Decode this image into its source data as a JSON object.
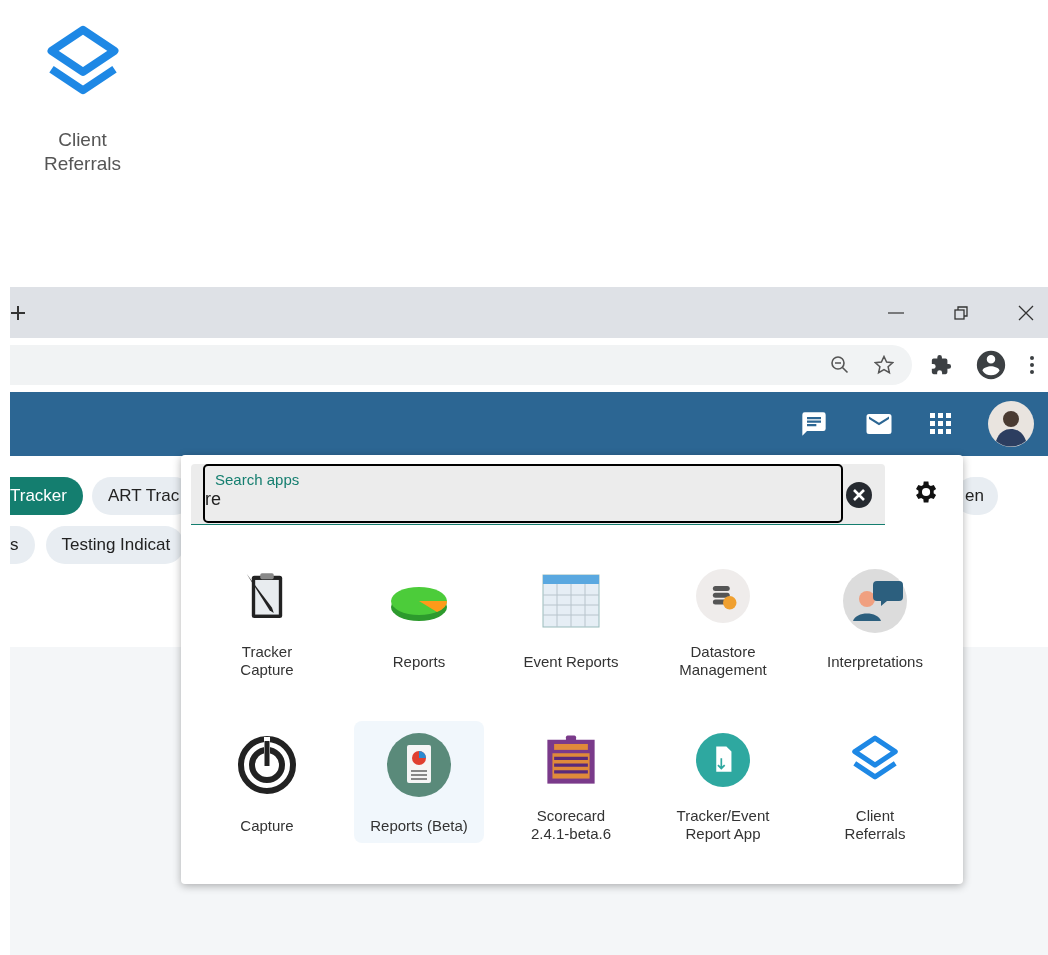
{
  "desktop_shortcut": {
    "label": "Client\nReferrals"
  },
  "chips_row_1": [
    {
      "label": "Tracker",
      "selected": true
    },
    {
      "label": "ART Trac",
      "selected": false
    }
  ],
  "chips_row_1_right": [
    {
      "label": "en",
      "selected": false
    }
  ],
  "chips_row_2": [
    {
      "label": "s",
      "selected": false
    },
    {
      "label": "Testing Indicat",
      "selected": false
    }
  ],
  "app_menu": {
    "search": {
      "label": "Search apps",
      "value": "re"
    },
    "apps": [
      {
        "name": "Tracker\nCapture",
        "selected": false
      },
      {
        "name": "Reports",
        "selected": false
      },
      {
        "name": "Event Reports",
        "selected": false
      },
      {
        "name": "Datastore\nManagement",
        "selected": false
      },
      {
        "name": "Interpretations",
        "selected": false
      },
      {
        "name": "Capture",
        "selected": false
      },
      {
        "name": "Reports (Beta)",
        "selected": true
      },
      {
        "name": "Scorecard\n2.4.1-beta.6",
        "selected": false
      },
      {
        "name": "Tracker/Event\nReport App",
        "selected": false
      },
      {
        "name": "Client\nReferrals",
        "selected": false
      }
    ]
  }
}
